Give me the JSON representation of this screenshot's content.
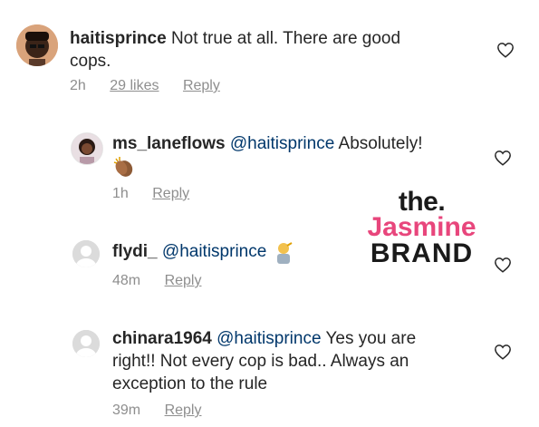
{
  "comments": [
    {
      "username": "haitisprince",
      "text_line1": "Not true at all. There are good",
      "text_line2": "cops.",
      "time": "2h",
      "likes": "29 likes",
      "reply": "Reply",
      "avatar_icon": "user-photo",
      "like_icon": "heart-outline-icon"
    },
    {
      "username": "ms_laneflows",
      "mention": "@haitisprince",
      "text": "Absolutely!",
      "emoji": "clapping-hands",
      "time": "1h",
      "reply": "Reply",
      "avatar_icon": "user-photo",
      "like_icon": "heart-outline-icon"
    },
    {
      "username": "flydi_",
      "mention": "@haitisprince",
      "emoji": "person-gesturing",
      "time": "48m",
      "reply": "Reply",
      "avatar_icon": "default-avatar",
      "like_icon": "heart-outline-icon"
    },
    {
      "username": "chinara1964",
      "mention": "@haitisprince",
      "text_line1": "Yes you are",
      "text_line2": "right!! Not every cop is bad.. Always an",
      "text_line3": "exception to the rule",
      "time": "39m",
      "reply": "Reply",
      "avatar_icon": "default-avatar",
      "like_icon": "heart-outline-icon"
    }
  ],
  "watermark": {
    "line1": "the.",
    "line2": "Jasmine",
    "line3": "BRAND",
    "accent": "#e8467c"
  },
  "colors": {
    "text": "#262626",
    "meta": "#8e8e8e",
    "mention": "#00376b"
  }
}
